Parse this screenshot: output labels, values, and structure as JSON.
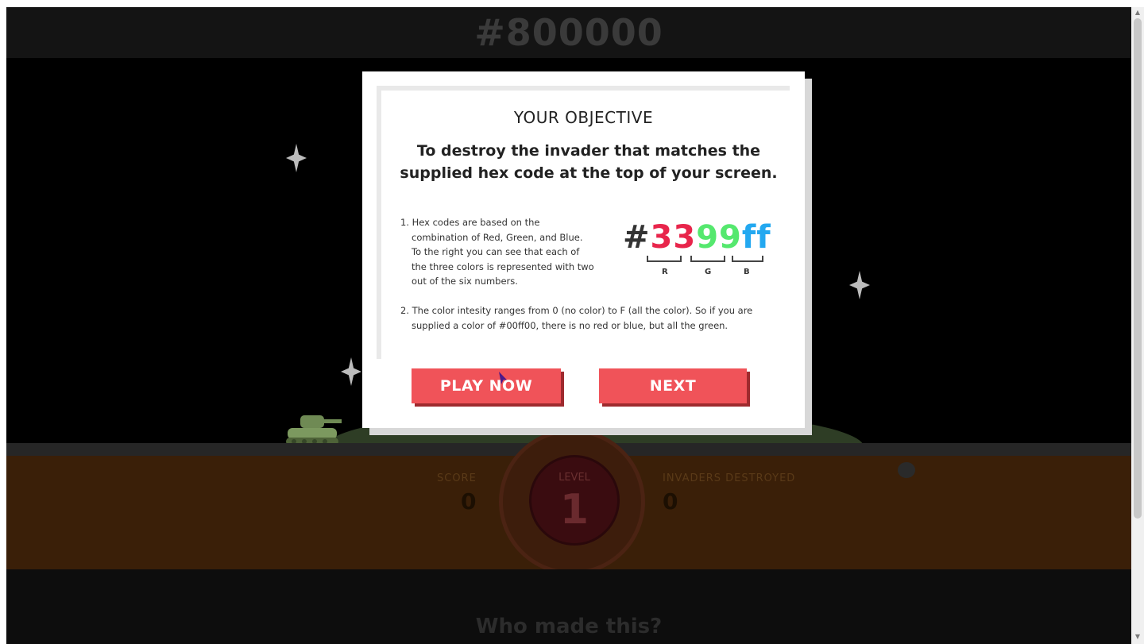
{
  "game": {
    "hex_target": "#800000",
    "stats": {
      "score_label": "SCORE",
      "score_value": "0",
      "invaders_label": "INVADERS DESTROYED",
      "invaders_value": "0"
    },
    "level": {
      "label": "LEVEL",
      "number": "1"
    },
    "footer_title": "Who made this?"
  },
  "modal": {
    "heading": "YOUR OBJECTIVE",
    "subheading": "To destroy the invader that matches the supplied hex code at the top of your screen.",
    "instruction_1": {
      "lines": [
        "1. Hex codes are based on the",
        "combination of Red, Green, and Blue.",
        "To the right you can see that each of",
        "the three colors is represented with two",
        "out of the six numbers."
      ]
    },
    "instruction_2": {
      "lines": [
        "2. The color intesity ranges from 0 (no color) to F (all the color). So if you are",
        "supplied a color of #00ff00, there is no red or blue, but all the green."
      ]
    },
    "hex_example": {
      "hash": "#",
      "red": "33",
      "green": "99",
      "blue": "ff",
      "labels": {
        "r": "R",
        "g": "G",
        "b": "B"
      }
    },
    "buttons": {
      "play": "PLAY NOW",
      "next": "NEXT"
    }
  },
  "colors": {
    "accent_button": "#f05359",
    "hex_red": "#e8254b",
    "hex_green": "#55e86e",
    "hex_blue": "#23a8f0"
  }
}
